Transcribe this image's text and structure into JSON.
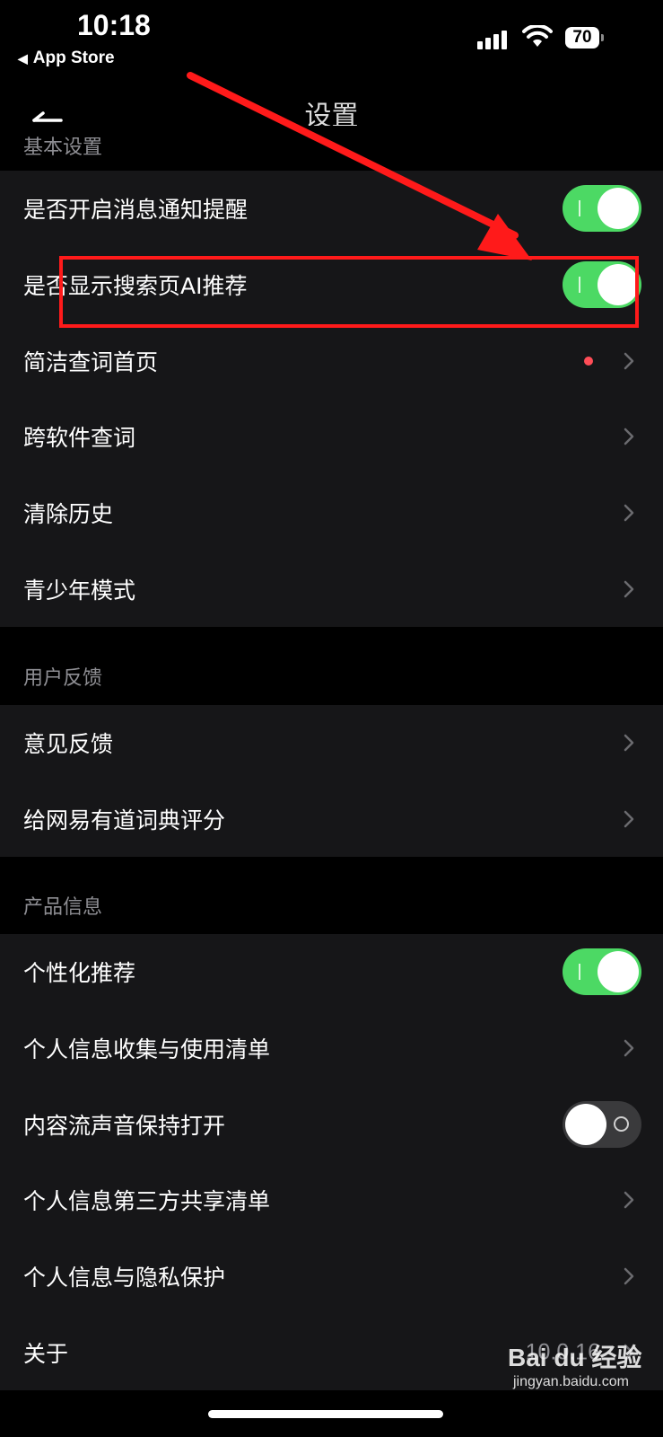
{
  "status_bar": {
    "time": "10:18",
    "back_app": "App Store",
    "battery": "70"
  },
  "navbar": {
    "title": "设置"
  },
  "sections": [
    {
      "header": "基本设置",
      "rows": [
        {
          "label": "是否开启消息通知提醒",
          "control": "toggle",
          "on": true
        },
        {
          "label": "是否显示搜索页AI推荐",
          "control": "toggle",
          "on": true
        },
        {
          "label": "简洁查词首页",
          "control": "chevron",
          "dot": true
        },
        {
          "label": "跨软件查词",
          "control": "chevron"
        },
        {
          "label": "清除历史",
          "control": "chevron"
        },
        {
          "label": "青少年模式",
          "control": "chevron"
        }
      ]
    },
    {
      "header": "用户反馈",
      "rows": [
        {
          "label": "意见反馈",
          "control": "chevron"
        },
        {
          "label": "给网易有道词典评分",
          "control": "chevron"
        }
      ]
    },
    {
      "header": "产品信息",
      "rows": [
        {
          "label": "个性化推荐",
          "control": "toggle",
          "on": true
        },
        {
          "label": "个人信息收集与使用清单",
          "control": "chevron"
        },
        {
          "label": "内容流声音保持打开",
          "control": "toggle",
          "on": false
        },
        {
          "label": "个人信息第三方共享清单",
          "control": "chevron"
        },
        {
          "label": "个人信息与隐私保护",
          "control": "chevron"
        },
        {
          "label": "关于",
          "control": "chevron",
          "value": "10.0.16"
        }
      ]
    }
  ],
  "colors": {
    "toggle_on": "#4cd964",
    "toggle_off": "#3a3a3c",
    "annotation": "#ff1a1a",
    "dot": "#ff4d57"
  },
  "watermark": {
    "brand": "Bai du 经验",
    "url": "jingyan.baidu.com"
  }
}
